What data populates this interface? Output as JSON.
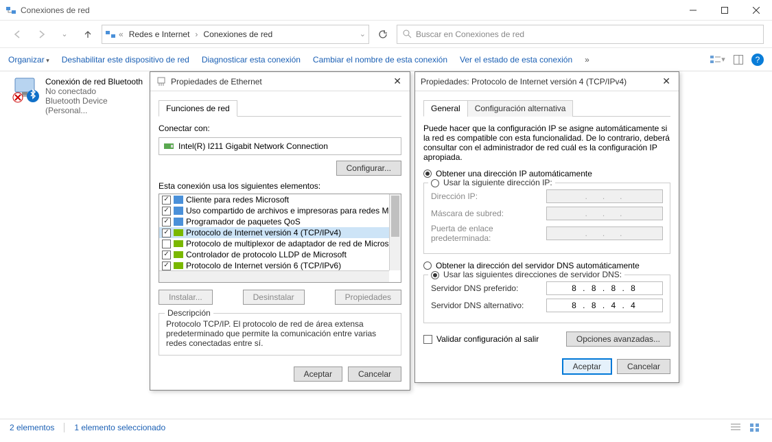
{
  "window": {
    "title": "Conexiones de red",
    "breadcrumb": [
      "Redes e Internet",
      "Conexiones de red"
    ],
    "search_placeholder": "Buscar en Conexiones de red"
  },
  "commands": {
    "organize": "Organizar",
    "disable": "Deshabilitar este dispositivo de red",
    "diagnose": "Diagnosticar esta conexión",
    "rename": "Cambiar el nombre de esta conexión",
    "status": "Ver el estado de esta conexión"
  },
  "item": {
    "name": "Conexión de red Bluetooth",
    "status": "No conectado",
    "device": "Bluetooth Device (Personal..."
  },
  "eth_dialog": {
    "title": "Propiedades de Ethernet",
    "tab": "Funciones de red",
    "connect_with": "Conectar con:",
    "adapter": "Intel(R) I211 Gigabit Network Connection",
    "configure": "Configurar...",
    "uses_label": "Esta conexión usa los siguientes elementos:",
    "items": [
      {
        "checked": true,
        "icon": "pc",
        "label": "Cliente para redes Microsoft"
      },
      {
        "checked": true,
        "icon": "pc",
        "label": "Uso compartido de archivos e impresoras para redes M"
      },
      {
        "checked": true,
        "icon": "pc",
        "label": "Programador de paquetes QoS"
      },
      {
        "checked": true,
        "icon": "net",
        "label": "Protocolo de Internet versión 4 (TCP/IPv4)",
        "selected": true
      },
      {
        "checked": false,
        "icon": "net",
        "label": "Protocolo de multiplexor de adaptador de red de Micros"
      },
      {
        "checked": true,
        "icon": "net",
        "label": "Controlador de protocolo LLDP de Microsoft"
      },
      {
        "checked": true,
        "icon": "net",
        "label": "Protocolo de Internet versión 6 (TCP/IPv6)"
      }
    ],
    "install": "Instalar...",
    "uninstall": "Desinstalar",
    "properties": "Propiedades",
    "desc_title": "Descripción",
    "desc_text": "Protocolo TCP/IP. El protocolo de red de área extensa predeterminado que permite la comunicación entre varias redes conectadas entre sí.",
    "ok": "Aceptar",
    "cancel": "Cancelar"
  },
  "ipv4_dialog": {
    "title": "Propiedades: Protocolo de Internet versión 4 (TCP/IPv4)",
    "tabs": {
      "general": "General",
      "alt": "Configuración alternativa"
    },
    "intro": "Puede hacer que la configuración IP se asigne automáticamente si la red es compatible con esta funcionalidad. De lo contrario, deberá consultar con el administrador de red cuál es la configuración IP apropiada.",
    "ip_auto": "Obtener una dirección IP automáticamente",
    "ip_manual": "Usar la siguiente dirección IP:",
    "ip_addr": "Dirección IP:",
    "mask": "Máscara de subred:",
    "gateway": "Puerta de enlace predeterminada:",
    "dns_auto": "Obtener la dirección del servidor DNS automáticamente",
    "dns_manual": "Usar las siguientes direcciones de servidor DNS:",
    "dns_pref": "Servidor DNS preferido:",
    "dns_pref_val": "8 . 8 . 8 . 8",
    "dns_alt": "Servidor DNS alternativo:",
    "dns_alt_val": "8 . 8 . 4 . 4",
    "validate": "Validar configuración al salir",
    "advanced": "Opciones avanzadas...",
    "ok": "Aceptar",
    "cancel": "Cancelar"
  },
  "status": {
    "count": "2 elementos",
    "selected": "1 elemento seleccionado"
  }
}
